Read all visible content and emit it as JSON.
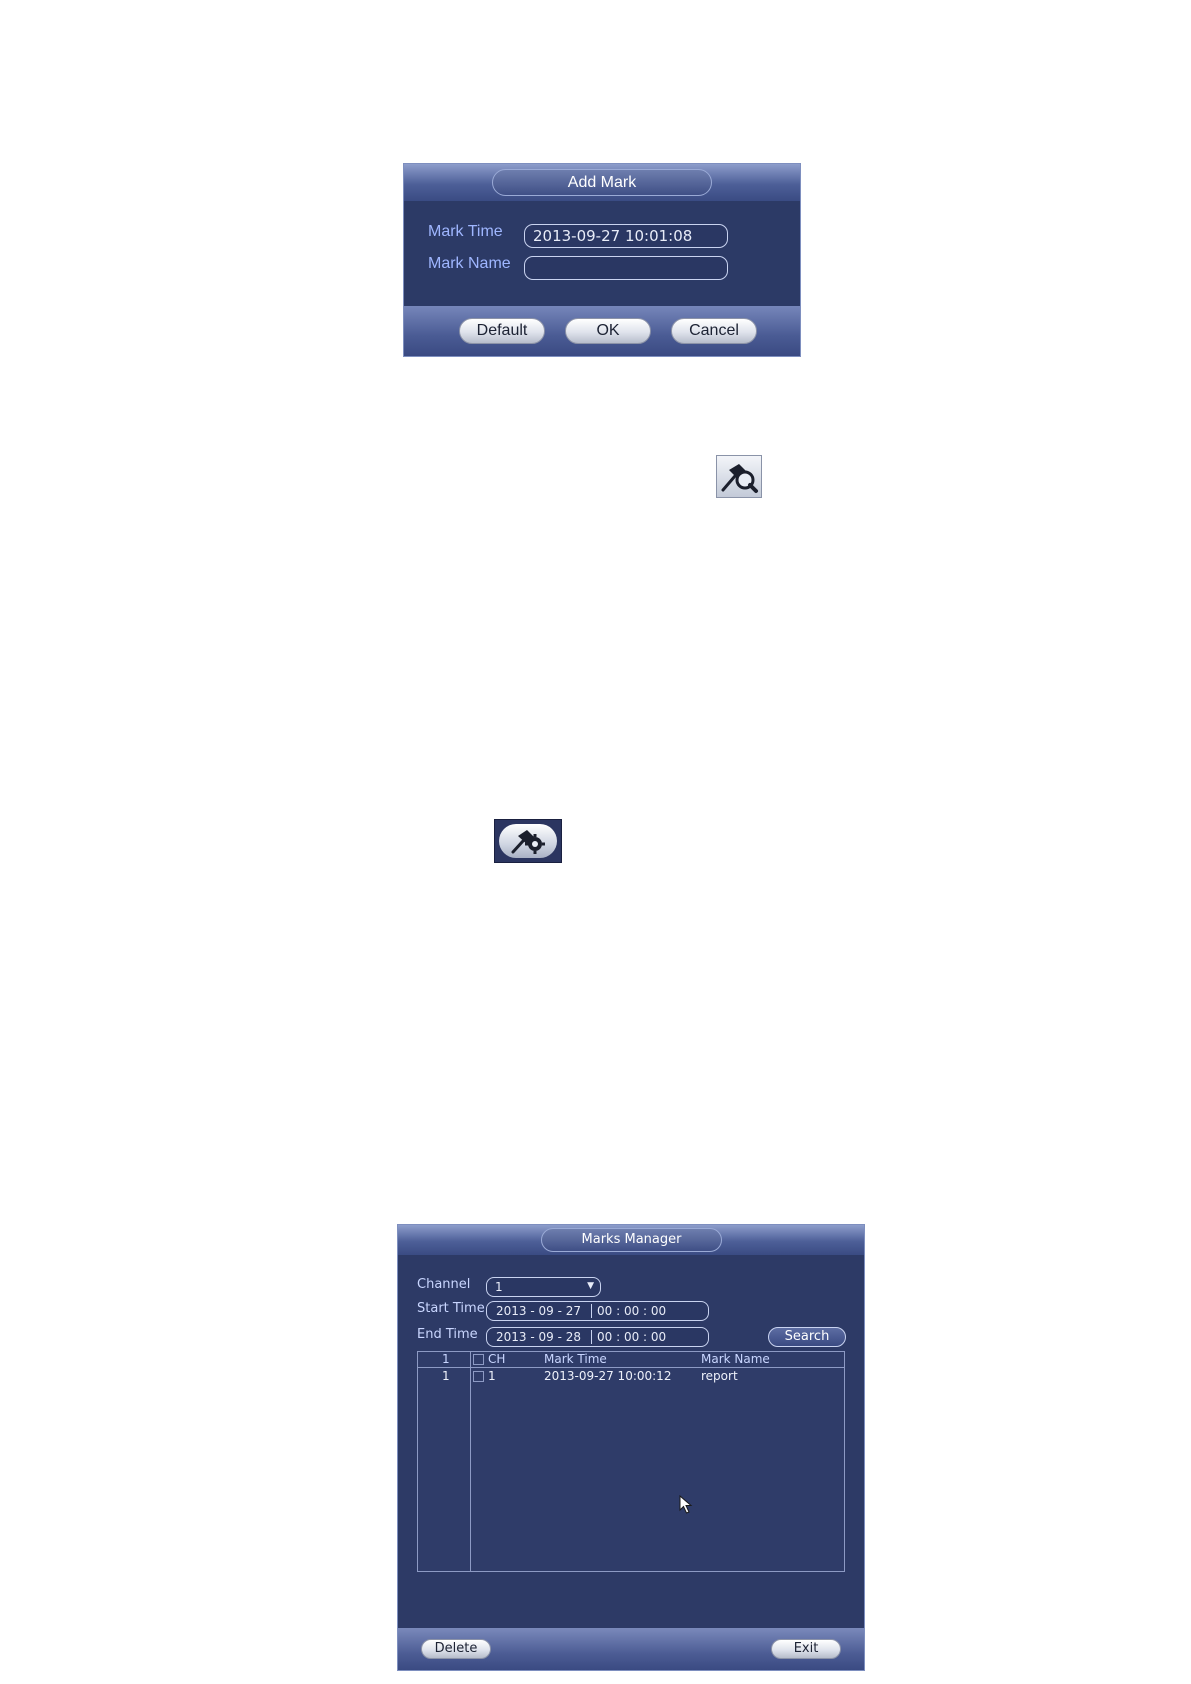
{
  "add_mark": {
    "title": "Add Mark",
    "mark_time_label": "Mark Time",
    "mark_time_value": "2013-09-27 10:01:08",
    "mark_name_label": "Mark Name",
    "mark_name_value": "",
    "buttons": {
      "default": "Default",
      "ok": "OK",
      "cancel": "Cancel"
    }
  },
  "icons": {
    "search_mark": "search-mark-icon",
    "mark_manager": "mark-manager-icon"
  },
  "marks_manager": {
    "title": "Marks Manager",
    "channel_label": "Channel",
    "channel_value": "1",
    "start_time_label": "Start Time",
    "start_date": "2013 - 09 - 27",
    "start_time": "00 : 00 : 00",
    "end_time_label": "End Time",
    "end_date": "2013 - 09 - 28",
    "end_time": "00 : 00 : 00",
    "search_button": "Search",
    "table": {
      "headers": {
        "index": "1",
        "ch": "CH",
        "mark_time": "Mark Time",
        "mark_name": "Mark Name"
      },
      "rows": [
        {
          "index": "1",
          "ch": "1",
          "mark_time": "2013-09-27 10:00:12",
          "mark_name": "report"
        }
      ]
    },
    "delete_button": "Delete",
    "exit_button": "Exit"
  }
}
